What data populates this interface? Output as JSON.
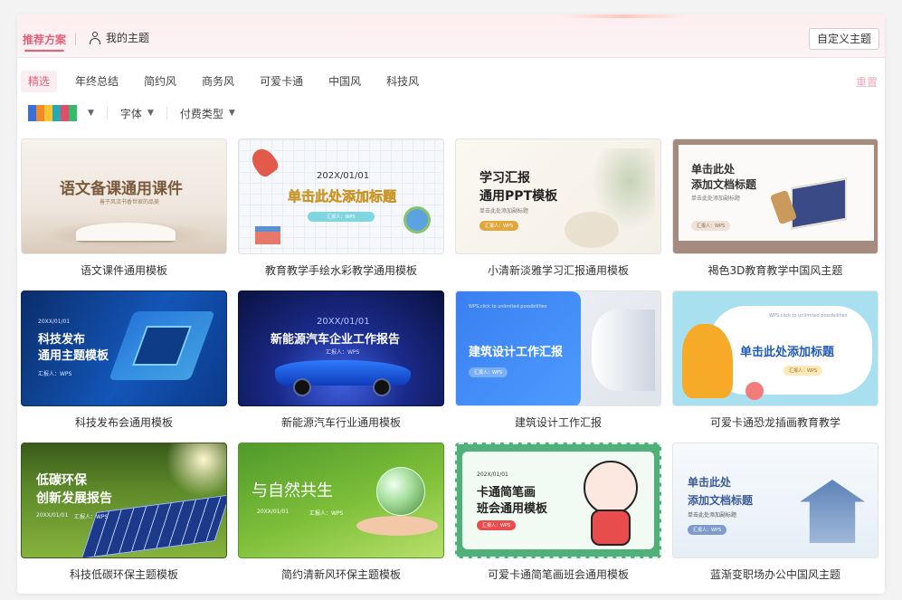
{
  "header": {
    "tab_recommended": "推荐方案",
    "tab_my_themes": "我的主题",
    "custom_theme_button": "自定义主题"
  },
  "categories": [
    "精选",
    "年终总结",
    "简约风",
    "商务风",
    "可爱卡通",
    "中国风",
    "科技风"
  ],
  "active_category": "精选",
  "reset_label": "重置",
  "filters": {
    "color_swatches": [
      "#3b6fd8",
      "#f08a2a",
      "#f4c531",
      "#27a8b5",
      "#e24d6a",
      "#37b86b"
    ],
    "font_label": "字体",
    "pay_type_label": "付费类型"
  },
  "colors": {
    "accent": "#e0607a"
  },
  "templates": [
    {
      "caption": "语文课件通用模板",
      "thumb_title": "语文备课通用课件",
      "thumb_sub": "善于风流书香世家的品美"
    },
    {
      "caption": "教育教学手绘水彩教学通用模板",
      "thumb_date": "202X/01/01",
      "thumb_title": "单击此处添加标题",
      "thumb_pill": "汇报人：WPS"
    },
    {
      "caption": "小清新淡雅学习汇报通用模板",
      "thumb_title": "学习汇报",
      "thumb_title2": "通用PPT模板",
      "thumb_sub": "单击此处添加副标题",
      "thumb_pill": "汇报人：WPS"
    },
    {
      "caption": "褐色3D教育教学中国风主题",
      "thumb_title": "单击此处",
      "thumb_title2": "添加文档标题",
      "thumb_sub": "单击此处添加副标题",
      "thumb_pill": "汇报人：WPS"
    },
    {
      "caption": "科技发布会通用模板",
      "thumb_date": "20XX/01/01",
      "thumb_title": "科技发布",
      "thumb_title2": "通用主题模板",
      "thumb_pill": "汇报人：WPS"
    },
    {
      "caption": "新能源汽车行业通用模板",
      "thumb_date": "20XX/01/01",
      "thumb_title": "新能源汽车企业工作报告",
      "thumb_pill": "汇报人：WPS"
    },
    {
      "caption": "建筑设计工作汇报",
      "thumb_sub": "WPS,click to unlimited possibilities",
      "thumb_title": "建筑设计工作汇报",
      "thumb_pill": "汇报人：WPS"
    },
    {
      "caption": "可爱卡通恐龙插画教育教学",
      "thumb_sub": "WPS,click to unlimited possibilities",
      "thumb_title": "单击此处添加标题",
      "thumb_pill": "汇报人：WPS"
    },
    {
      "caption": "科技低碳环保主题模板",
      "thumb_title": "低碳环保",
      "thumb_title2": "创新发展报告",
      "thumb_date": "20XX/01/01",
      "thumb_pill": "汇报人：WPS"
    },
    {
      "caption": "简约清新风环保主题模板",
      "thumb_title": "与自然共生",
      "thumb_date": "20XX/01/01",
      "thumb_pill": "汇报人：WPS"
    },
    {
      "caption": "可爱卡通简笔画班会通用模板",
      "thumb_date": "202X/01/01",
      "thumb_title": "卡通简笔画",
      "thumb_title2": "班会通用模板",
      "thumb_pill": "汇报人：WPS"
    },
    {
      "caption": "蓝渐变职场办公中国风主题",
      "thumb_title": "单击此处",
      "thumb_title2": "添加文档标题",
      "thumb_sub": "单击此处添加副标题",
      "thumb_pill": "汇报人：WPS"
    }
  ]
}
